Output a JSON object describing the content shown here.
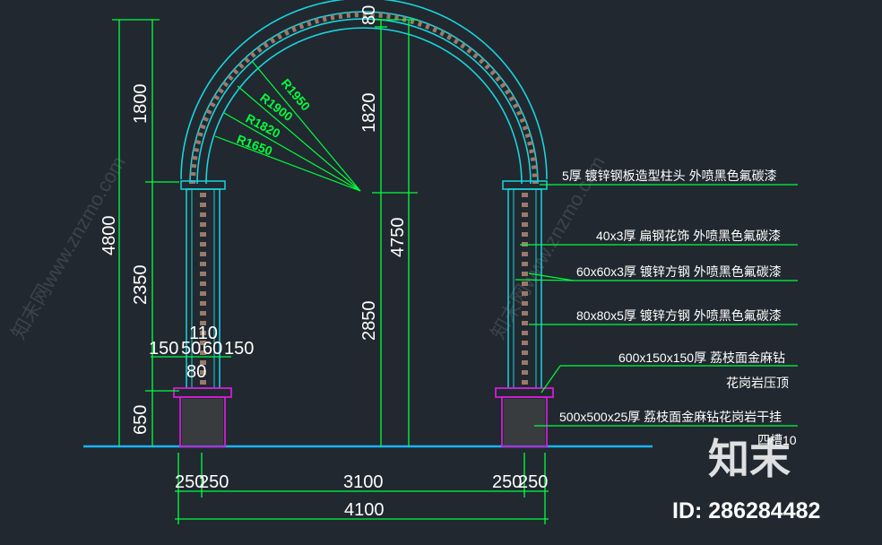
{
  "colors": {
    "background": "#212830",
    "dimension_line": "#00ff3c",
    "arch_outline": "#19d5dc",
    "base_outline": "#d11dd1",
    "ground": "#1ab3ff",
    "text": "#ffffff"
  },
  "dimensions": {
    "top_thickness": "80",
    "arch_height_right": "1820",
    "left_upper": "1800",
    "left_middle": "2350",
    "left_lower": "650",
    "overall_left": "4800",
    "overall_right": "4750",
    "right_lower": "2850",
    "col_top": "110",
    "col_parts": [
      "150",
      "50",
      "60",
      "150"
    ],
    "col_bottom": "80",
    "bottom_row": [
      "250",
      "250",
      "3100",
      "250",
      "250"
    ],
    "total_width": "4100"
  },
  "radii": [
    "R1950",
    "R1900",
    "R1820",
    "R1650"
  ],
  "annotations": [
    "5厚 镀锌钢板造型柱头 外喷黑色氟碳漆",
    "40x3厚 扁钢花饰 外喷黑色氟碳漆",
    "60x60x3厚 镀锌方钢 外喷黑色氟碳漆",
    "80x80x5厚 镀锌方钢 外喷黑色氟碳漆",
    "600x150x150厚 荔枝面金麻钻",
    "花岗岩压顶",
    "500x500x25厚 荔枝面金麻钻花岗岩干挂",
    "四槽10"
  ],
  "watermark": {
    "logo": "知末",
    "id": "ID: 286284482",
    "diagonal": "知末网www.znzmo.com"
  }
}
